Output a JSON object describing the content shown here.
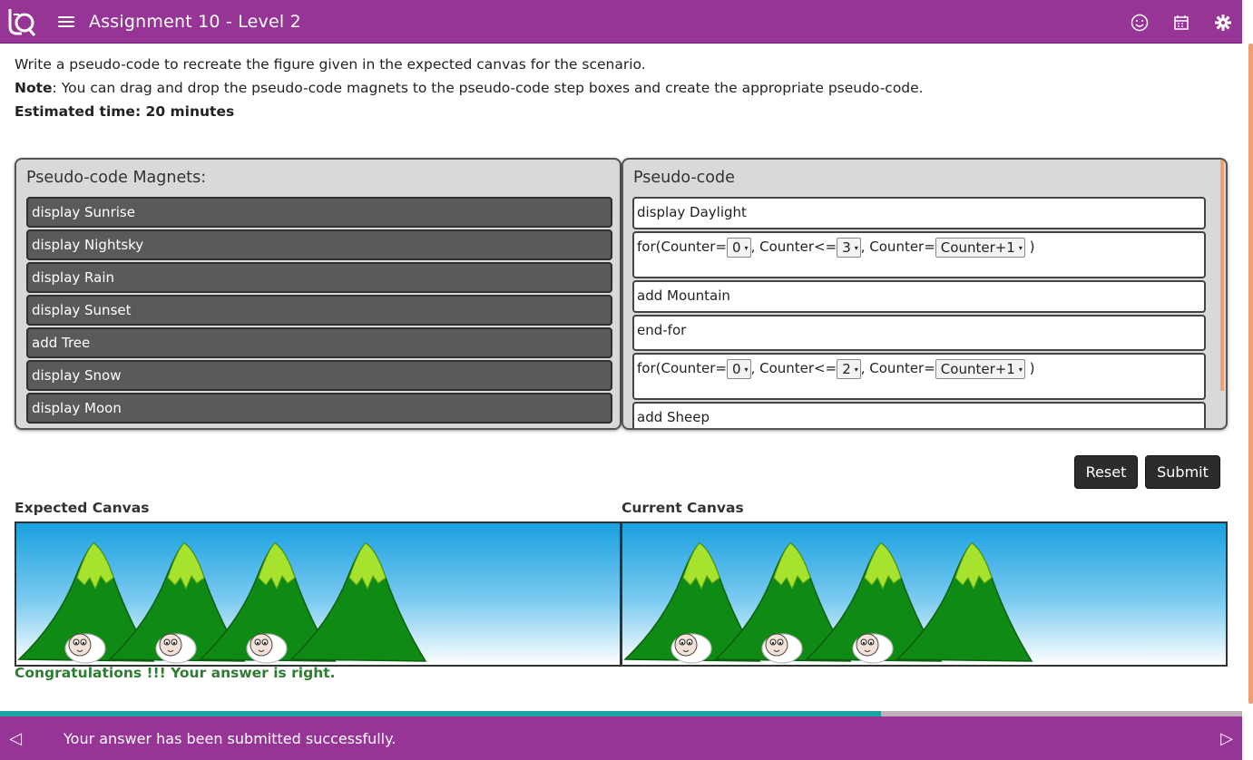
{
  "header": {
    "title": "Assignment 10 - Level 2",
    "colors": {
      "bar": "#963596"
    }
  },
  "instructions": {
    "line1": "Write a pseudo-code to recreate the figure given in the expected canvas for the scenario.",
    "note_label": "Note",
    "note_text": ": You can drag and drop the pseudo-code magnets to the pseudo-code step boxes and create the appropriate pseudo-code.",
    "time": "Estimated time: 20 minutes"
  },
  "magnets_panel": {
    "title": "Pseudo-code Magnets:",
    "items": [
      "display Sunrise",
      "display Nightsky",
      "display Rain",
      "display Sunset",
      "add Tree",
      "display Snow",
      "display Moon"
    ]
  },
  "code_panel": {
    "title": "Pseudo-code",
    "steps": {
      "s1": "display Daylight",
      "loop1": {
        "prefix": "for(Counter=",
        "start": "0",
        "mid": ", Counter<=",
        "end": "3",
        "mid2": ", Counter=",
        "inc": "Counter+1",
        "close": " )"
      },
      "s3": "add Mountain",
      "s4": "end-for",
      "loop2": {
        "prefix": "for(Counter=",
        "start": "0",
        "mid": ", Counter<=",
        "end": "2",
        "mid2": ", Counter=",
        "inc": "Counter+1",
        "close": " )"
      },
      "s6": "add Sheep"
    }
  },
  "buttons": {
    "reset": "Reset",
    "submit": "Submit"
  },
  "canvases": {
    "expected_label": "Expected Canvas",
    "current_label": "Current Canvas",
    "mountain_count": 4,
    "sheep_count": 3
  },
  "result": "Congratulations !!! Your answer is right.",
  "footer": {
    "message": "Your answer has been submitted successfully.",
    "progress": 0.709
  }
}
